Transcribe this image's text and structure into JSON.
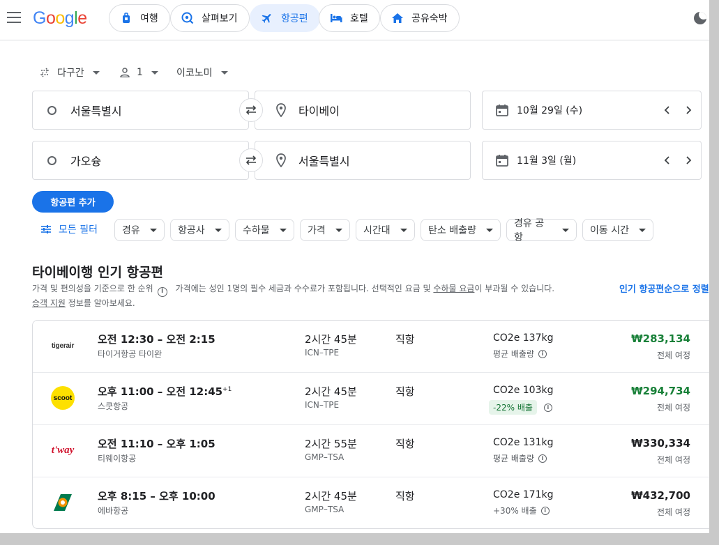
{
  "header": {
    "logo": "Google",
    "nav": [
      {
        "label": "여행",
        "icon": "travel-bag-icon"
      },
      {
        "label": "살펴보기",
        "icon": "explore-icon"
      },
      {
        "label": "항공편",
        "icon": "flight-icon",
        "active": true
      },
      {
        "label": "호텔",
        "icon": "hotel-bed-icon"
      },
      {
        "label": "공유숙박",
        "icon": "home-icon"
      }
    ]
  },
  "search": {
    "trip_type": "다구간",
    "passengers": "1",
    "cabin": "이코노미",
    "legs": [
      {
        "from": "서울특별시",
        "to": "타이베이",
        "date": "10월 29일 (수)"
      },
      {
        "from": "가오슝",
        "to": "서울특별시",
        "date": "11월 3일 (월)"
      }
    ],
    "add_flight": "항공편 추가"
  },
  "filters": {
    "all_filters": "모든 필터",
    "chips": [
      "경유",
      "항공사",
      "수하물",
      "가격",
      "시간대",
      "탄소 배출량",
      "경유 공항",
      "이동 시간"
    ]
  },
  "results": {
    "title": "타이베이행 인기 항공편",
    "ranking_note": "가격 및 편의성을 기준으로 한 순위",
    "fees_note_a": "가격에는 성인 1명의 필수 세금과 수수료가 포함됩니다. 선택적인 요금 및 ",
    "fees_link": "수하물 요금",
    "fees_note_b": "이 부과될 수 있습니다.",
    "assist_link": "승객 지원",
    "assist_suffix": " 정보를 알아보세요.",
    "sort_label": "인기 항공편순으로 정렬됨",
    "flights": [
      {
        "logo": "tigerair",
        "times": "오전 12:30 – 오전 2:15",
        "plus_days": "",
        "airline": "타이거항공 타이완",
        "duration": "2시간 45분",
        "route": "ICN–TPE",
        "stops": "직항",
        "co2": "CO2e 137kg",
        "emissions": "평균 배출량",
        "emissions_badge": false,
        "price": "₩283,134",
        "price_low": true,
        "price_type": "전체 여정"
      },
      {
        "logo": "scoot",
        "times": "오후 11:00 – 오전 12:45",
        "plus_days": "+1",
        "airline": "스쿳항공",
        "duration": "2시간 45분",
        "route": "ICN–TPE",
        "stops": "직항",
        "co2": "CO2e 103kg",
        "emissions": "-22% 배출",
        "emissions_badge": true,
        "price": "₩294,734",
        "price_low": true,
        "price_type": "전체 여정"
      },
      {
        "logo": "t'way",
        "times": "오전 11:10 – 오후 1:05",
        "plus_days": "",
        "airline": "티웨이항공",
        "duration": "2시간 55분",
        "route": "GMP–TSA",
        "stops": "직항",
        "co2": "CO2e 131kg",
        "emissions": "평균 배출량",
        "emissions_badge": false,
        "price": "₩330,334",
        "price_low": false,
        "price_type": "전체 여정"
      },
      {
        "logo": "",
        "times": "오후 8:15 – 오후 10:00",
        "plus_days": "",
        "airline": "에바항공",
        "duration": "2시간 45분",
        "route": "GMP–TSA",
        "stops": "직항",
        "co2": "CO2e 171kg",
        "emissions": "+30% 배출",
        "emissions_badge": false,
        "price": "₩432,700",
        "price_low": false,
        "price_type": "전체 여정"
      }
    ]
  },
  "colors": {
    "accent": "#1a73e8",
    "price_green": "#188038",
    "badge_bg": "#e6f4ea"
  }
}
